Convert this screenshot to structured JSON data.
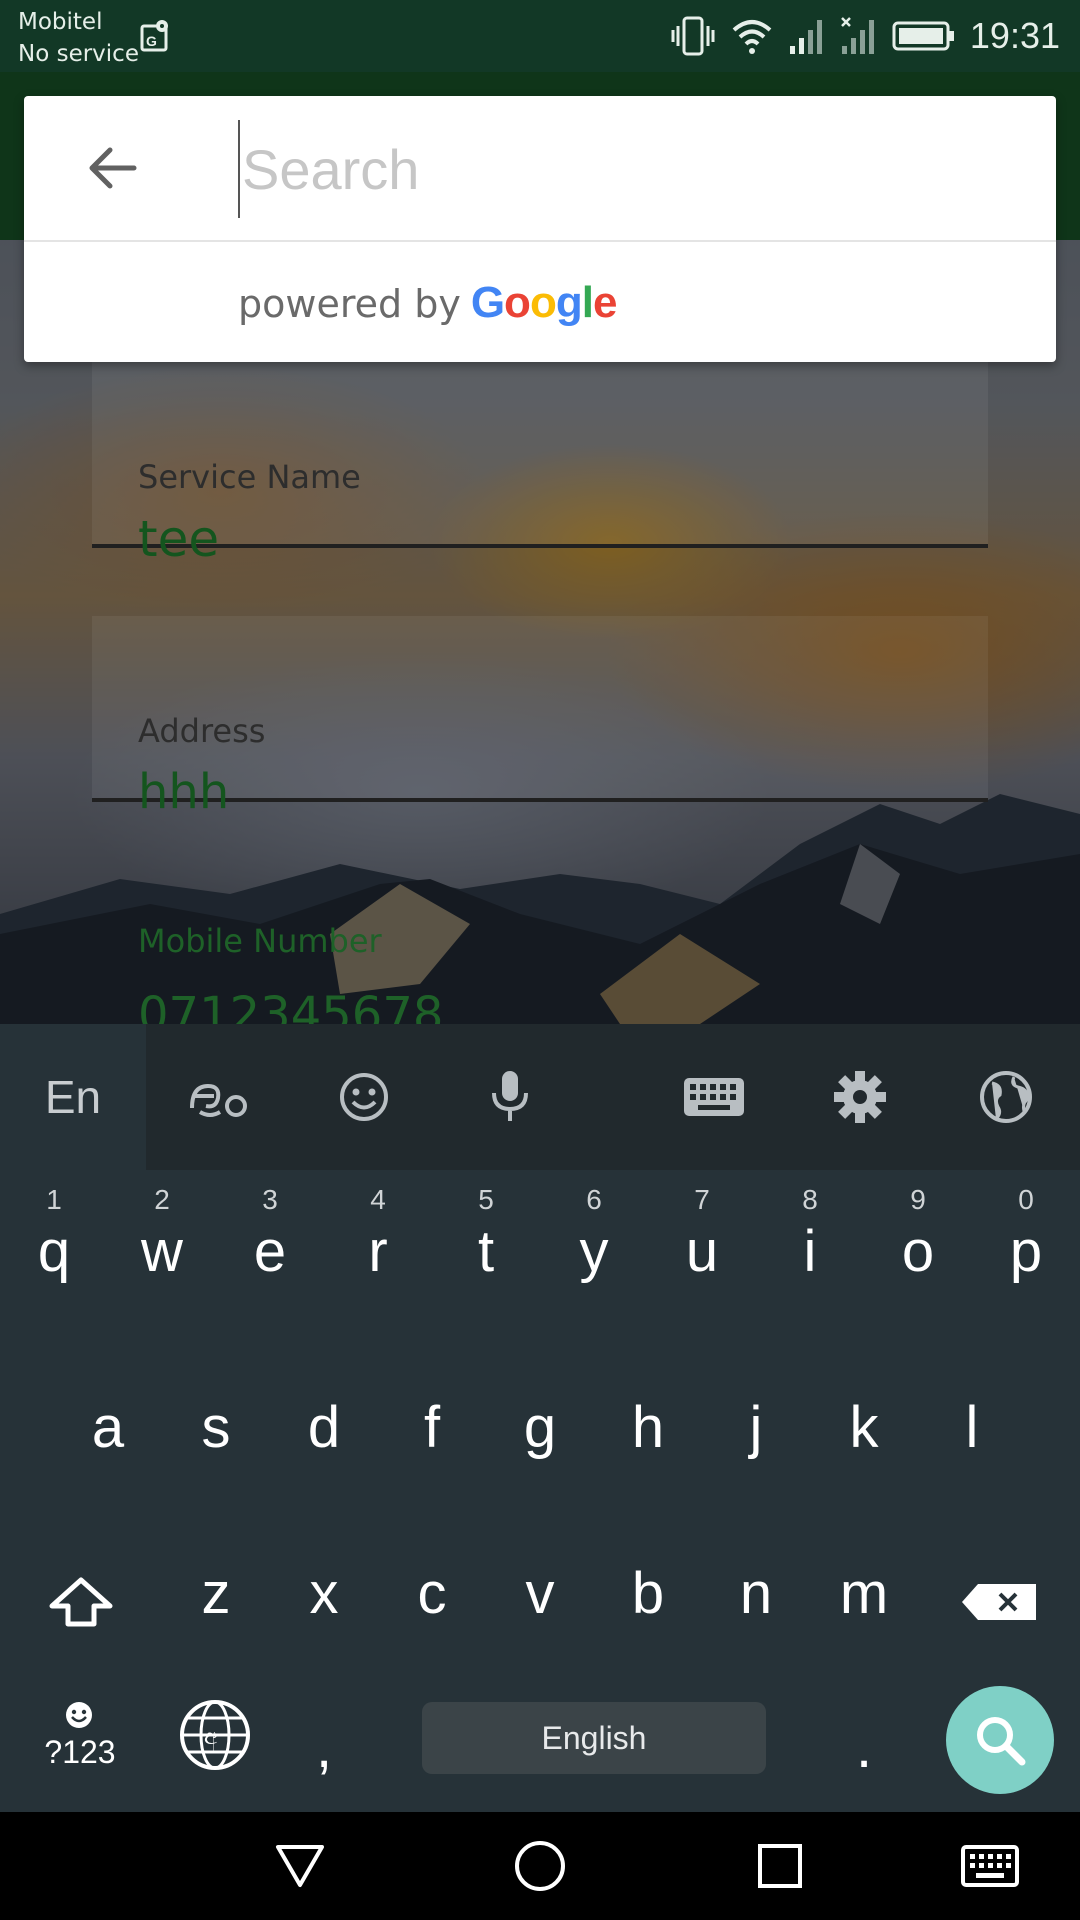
{
  "status_bar": {
    "carrier": "Mobitel",
    "service": "No service",
    "time": "19:31"
  },
  "form": {
    "service_name_label": "Service Name",
    "service_name_value": "tee",
    "address_label": "Address",
    "address_value": "hhh",
    "mobile_label": "Mobile Number",
    "mobile_value": "0712345678"
  },
  "search": {
    "placeholder": "Search",
    "value": "",
    "powered_by": "powered by",
    "google_letters": [
      "G",
      "o",
      "o",
      "g",
      "l",
      "e"
    ],
    "google_colors": [
      "#4285F4",
      "#EA4335",
      "#FBBC05",
      "#4285F4",
      "#34A853",
      "#EA4335"
    ]
  },
  "keyboard": {
    "lang_label": "En",
    "row1": [
      {
        "hint": "1",
        "ch": "q"
      },
      {
        "hint": "2",
        "ch": "w"
      },
      {
        "hint": "3",
        "ch": "e"
      },
      {
        "hint": "4",
        "ch": "r"
      },
      {
        "hint": "5",
        "ch": "t"
      },
      {
        "hint": "6",
        "ch": "y"
      },
      {
        "hint": "7",
        "ch": "u"
      },
      {
        "hint": "8",
        "ch": "i"
      },
      {
        "hint": "9",
        "ch": "o"
      },
      {
        "hint": "0",
        "ch": "p"
      }
    ],
    "row2": [
      "a",
      "s",
      "d",
      "f",
      "g",
      "h",
      "j",
      "k",
      "l"
    ],
    "row3": [
      "z",
      "x",
      "c",
      "v",
      "b",
      "n",
      "m"
    ],
    "symbols_label": "?123",
    "comma": ",",
    "space_label": "English",
    "period": ".",
    "accent_color": "#7fd0c6"
  }
}
